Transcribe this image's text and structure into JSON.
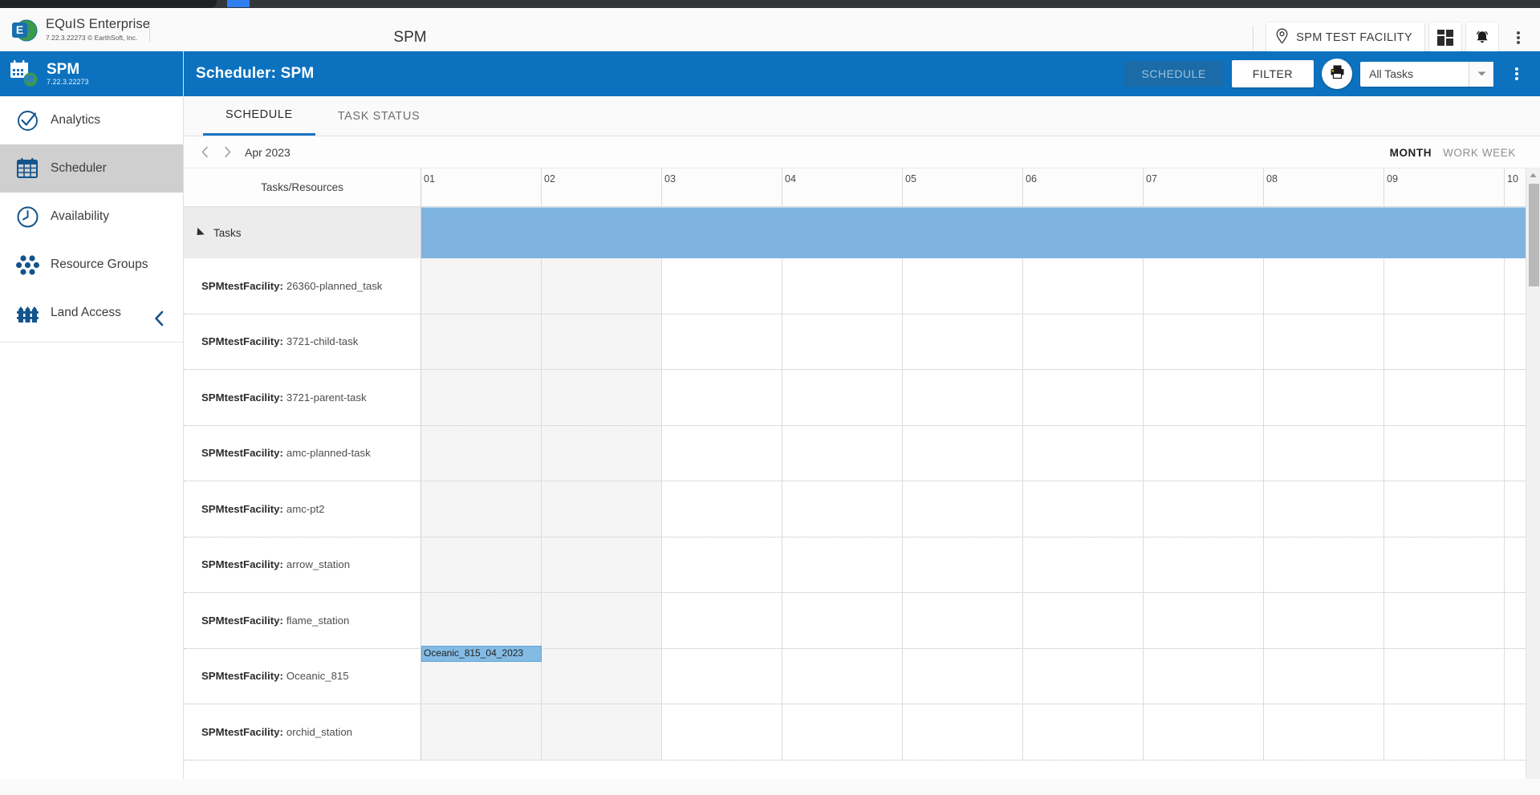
{
  "browser": {
    "chrome_color": "#323639"
  },
  "appbar": {
    "brand_title": "EQuIS Enterprise",
    "brand_version": "7.22.3.22273 © EarthSoft, Inc.",
    "page_title": "SPM",
    "facility_chip": "SPM TEST FACILITY",
    "icons": {
      "location_pin": "location-pin-icon",
      "dashboard_grid": "dashboard-grid-icon",
      "notifications_bell": "bell-icon",
      "overflow_menu": "kebab-menu-icon"
    }
  },
  "sidebar": {
    "app_name": "SPM",
    "app_version": "7.22.3.22273",
    "items": [
      {
        "label": "Analytics",
        "icon": "check-circle-icon",
        "active": false
      },
      {
        "label": "Scheduler",
        "icon": "calendar-grid-icon",
        "active": true
      },
      {
        "label": "Availability",
        "icon": "clock-icon",
        "active": false
      },
      {
        "label": "Resource Groups",
        "icon": "hexagon-cluster-icon",
        "active": false
      },
      {
        "label": "Land Access",
        "icon": "fence-icon",
        "active": false
      }
    ],
    "collapse_icon": "chevron-left-icon"
  },
  "scheduler_bar": {
    "title": "Scheduler: SPM",
    "schedule_button": "SCHEDULE",
    "filter_button": "FILTER",
    "print_icon": "printer-icon",
    "task_filter_value": "All Tasks",
    "dropdown_icon": "chevron-down-icon",
    "overflow_menu": "kebab-menu-icon",
    "accent_color": "#0c72bf",
    "schedule_disabled_bg": "#1a6ba7"
  },
  "tabs": [
    {
      "label": "SCHEDULE",
      "active": true
    },
    {
      "label": "TASK STATUS",
      "active": false
    }
  ],
  "datenav": {
    "prev_icon": "chevron-left-icon",
    "next_icon": "chevron-right-icon",
    "period_label": "Apr 2023",
    "view_modes": [
      {
        "label": "MONTH",
        "selected": true
      },
      {
        "label": "WORK WEEK",
        "selected": false
      }
    ]
  },
  "gantt": {
    "left_header": "Tasks/Resources",
    "day_columns": [
      "01",
      "02",
      "03",
      "04",
      "05",
      "06",
      "07",
      "08",
      "09",
      "10"
    ],
    "shaded_columns": [
      "01",
      "02"
    ],
    "group_row": {
      "label": "Tasks",
      "expanded": true,
      "band_color": "#7fb4e0"
    },
    "rows": [
      {
        "facility": "SPMtestFacility:",
        "name": "26360-planned_task",
        "bars": []
      },
      {
        "facility": "SPMtestFacility:",
        "name": "3721-child-task",
        "bars": []
      },
      {
        "facility": "SPMtestFacility:",
        "name": "3721-parent-task",
        "bars": []
      },
      {
        "facility": "SPMtestFacility:",
        "name": "amc-planned-task",
        "bars": []
      },
      {
        "facility": "SPMtestFacility:",
        "name": "amc-pt2",
        "bars": []
      },
      {
        "facility": "SPMtestFacility:",
        "name": "arrow_station",
        "bars": []
      },
      {
        "facility": "SPMtestFacility:",
        "name": "flame_station",
        "bars": []
      },
      {
        "facility": "SPMtestFacility:",
        "name": "Oceanic_815",
        "bars": [
          {
            "label": "Oceanic_815_04_2023",
            "start_col": 0,
            "span": 1,
            "color": "#84bbe4"
          }
        ]
      },
      {
        "facility": "SPMtestFacility:",
        "name": "orchid_station",
        "bars": []
      }
    ],
    "scrollbars": {
      "vertical_up_icon": "triangle-up-icon",
      "horizontal_left_icon": "triangle-left-icon",
      "horizontal_right_icon": "triangle-right-icon"
    }
  }
}
